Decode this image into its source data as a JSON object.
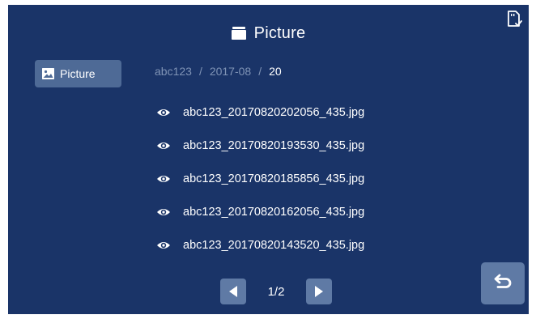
{
  "header": {
    "title": "Picture",
    "folder_icon": "folder-icon"
  },
  "status": {
    "sd_icon": "sd-card-check-icon"
  },
  "sidebar": {
    "tab_label": "Picture",
    "tab_icon": "image-icon"
  },
  "breadcrumb": {
    "parts": [
      "abc123",
      "2017-08",
      "20"
    ],
    "separator": "/"
  },
  "files": [
    {
      "name": "abc123_20170820202056_435.jpg",
      "icon": "eye-icon"
    },
    {
      "name": "abc123_20170820193530_435.jpg",
      "icon": "eye-icon"
    },
    {
      "name": "abc123_20170820185856_435.jpg",
      "icon": "eye-icon"
    },
    {
      "name": "abc123_20170820162056_435.jpg",
      "icon": "eye-icon"
    },
    {
      "name": "abc123_20170820143520_435.jpg",
      "icon": "eye-icon"
    }
  ],
  "pager": {
    "text": "1/2",
    "prev_icon": "prev-page-icon",
    "next_icon": "next-page-icon"
  },
  "back": {
    "icon": "back-arrow-icon"
  },
  "colors": {
    "background": "#1a3468",
    "button": "#5f7aa5",
    "tab": "#4e6a96",
    "breadcrumb_dim": "#7f93b5"
  }
}
